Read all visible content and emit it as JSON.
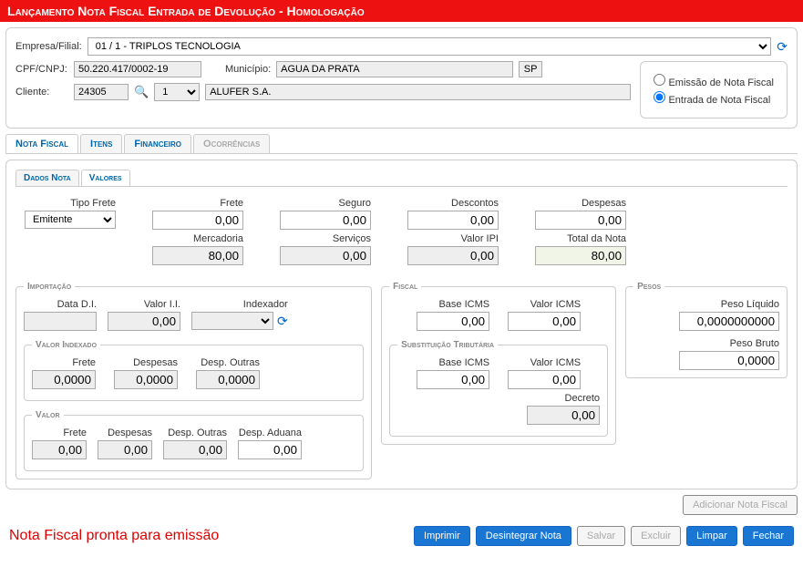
{
  "header": {
    "title": "Lançamento Nota Fiscal Entrada de Devolução  - Homologação"
  },
  "empresa": {
    "label": "Empresa/Filial:",
    "value": "01 / 1 - TRIPLOS TECNOLOGIA"
  },
  "cpf": {
    "label": "CPF/CNPJ:",
    "value": "50.220.417/0002-19"
  },
  "municipio": {
    "label": "Município:",
    "value": "AGUA DA PRATA",
    "uf": "SP"
  },
  "cliente": {
    "label": "Cliente:",
    "code": "24305",
    "seq": "1",
    "name": "ALUFER S.A."
  },
  "radios": {
    "emissao": "Emissão de Nota Fiscal",
    "entrada": "Entrada de Nota Fiscal"
  },
  "tabs": {
    "nota": "Nota Fiscal",
    "itens": "Itens",
    "fin": "Financeiro",
    "ocor": "Ocorrências"
  },
  "subtabs": {
    "dados": "Dados Nota",
    "valores": "Valores"
  },
  "valores": {
    "tipoFrete": {
      "label": "Tipo Frete",
      "value": "Emitente"
    },
    "frete": {
      "label": "Frete",
      "value": "0,00"
    },
    "seguro": {
      "label": "Seguro",
      "value": "0,00"
    },
    "descontos": {
      "label": "Descontos",
      "value": "0,00"
    },
    "despesas": {
      "label": "Despesas",
      "value": "0,00"
    },
    "mercadoria": {
      "label": "Mercadoria",
      "value": "80,00"
    },
    "servicos": {
      "label": "Serviços",
      "value": "0,00"
    },
    "valorIpi": {
      "label": "Valor IPI",
      "value": "0,00"
    },
    "totalNota": {
      "label": "Total da Nota",
      "value": "80,00"
    }
  },
  "importacao": {
    "legend": "Importação",
    "dataDI": {
      "label": "Data D.I.",
      "value": ""
    },
    "valorII": {
      "label": "Valor I.I.",
      "value": "0,00"
    },
    "indexador": {
      "label": "Indexador",
      "value": ""
    },
    "valorIndexado": {
      "legend": "Valor Indexado",
      "frete": {
        "label": "Frete",
        "value": "0,0000"
      },
      "despesas": {
        "label": "Despesas",
        "value": "0,0000"
      },
      "despOutras": {
        "label": "Desp. Outras",
        "value": "0,0000"
      }
    },
    "valor": {
      "legend": "Valor",
      "frete": {
        "label": "Frete",
        "value": "0,00"
      },
      "despesas": {
        "label": "Despesas",
        "value": "0,00"
      },
      "despOutras": {
        "label": "Desp. Outras",
        "value": "0,00"
      },
      "despAduana": {
        "label": "Desp. Aduana",
        "value": "0,00"
      }
    }
  },
  "fiscal": {
    "legend": "Fiscal",
    "baseIcms": {
      "label": "Base ICMS",
      "value": "0,00"
    },
    "valorIcms": {
      "label": "Valor ICMS",
      "value": "0,00"
    },
    "subst": {
      "legend": "Substituição Tributária",
      "baseIcms": {
        "label": "Base ICMS",
        "value": "0,00"
      },
      "valorIcms": {
        "label": "Valor ICMS",
        "value": "0,00"
      },
      "decreto": {
        "label": "Decreto",
        "value": "0,00"
      }
    }
  },
  "pesos": {
    "legend": "Pesos",
    "liquido": {
      "label": "Peso Líquido",
      "value": "0,0000000000"
    },
    "bruto": {
      "label": "Peso Bruto",
      "value": "0,0000"
    }
  },
  "buttons": {
    "adicionar": "Adicionar Nota Fiscal",
    "imprimir": "Imprimir",
    "desintegrar": "Desintegrar Nota",
    "salvar": "Salvar",
    "excluir": "Excluir",
    "limpar": "Limpar",
    "fechar": "Fechar"
  },
  "status": "Nota Fiscal pronta para emissão"
}
